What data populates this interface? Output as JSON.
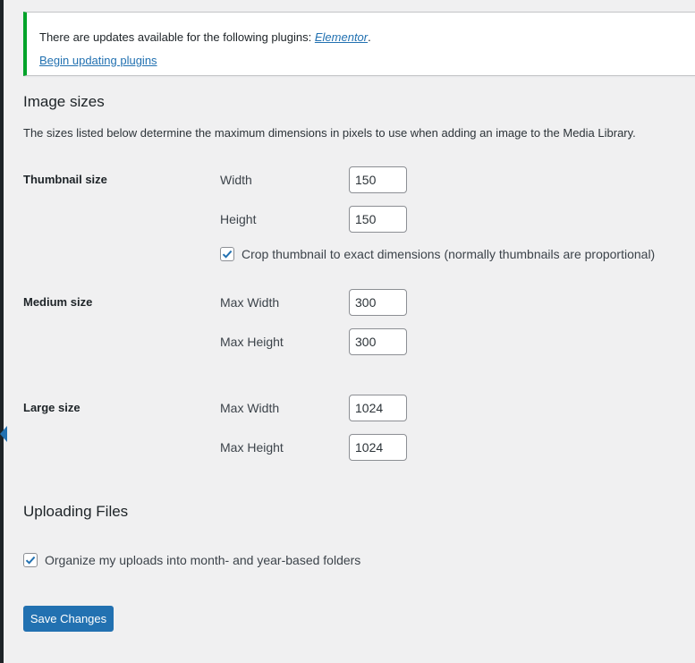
{
  "notice": {
    "text": "There are updates available for the following plugins: ",
    "plugin_link": "Elementor",
    "period": ".",
    "action_link": "Begin updating plugins"
  },
  "image_sizes": {
    "heading": "Image sizes",
    "description": "The sizes listed below determine the maximum dimensions in pixels to use when adding an image to the Media Library.",
    "thumbnail": {
      "label": "Thumbnail size",
      "width_label": "Width",
      "width_value": "150",
      "height_label": "Height",
      "height_value": "150",
      "crop_checked": true,
      "crop_label": "Crop thumbnail to exact dimensions (normally thumbnails are proportional)"
    },
    "medium": {
      "label": "Medium size",
      "width_label": "Max Width",
      "width_value": "300",
      "height_label": "Max Height",
      "height_value": "300"
    },
    "large": {
      "label": "Large size",
      "width_label": "Max Width",
      "width_value": "1024",
      "height_label": "Max Height",
      "height_value": "1024"
    }
  },
  "uploading": {
    "heading": "Uploading Files",
    "organize_checked": true,
    "organize_label": "Organize my uploads into month- and year-based folders"
  },
  "save_button": "Save Changes",
  "colors": {
    "accent": "#2271b1",
    "notice_success": "#00a32a",
    "background": "#f0f0f1"
  }
}
